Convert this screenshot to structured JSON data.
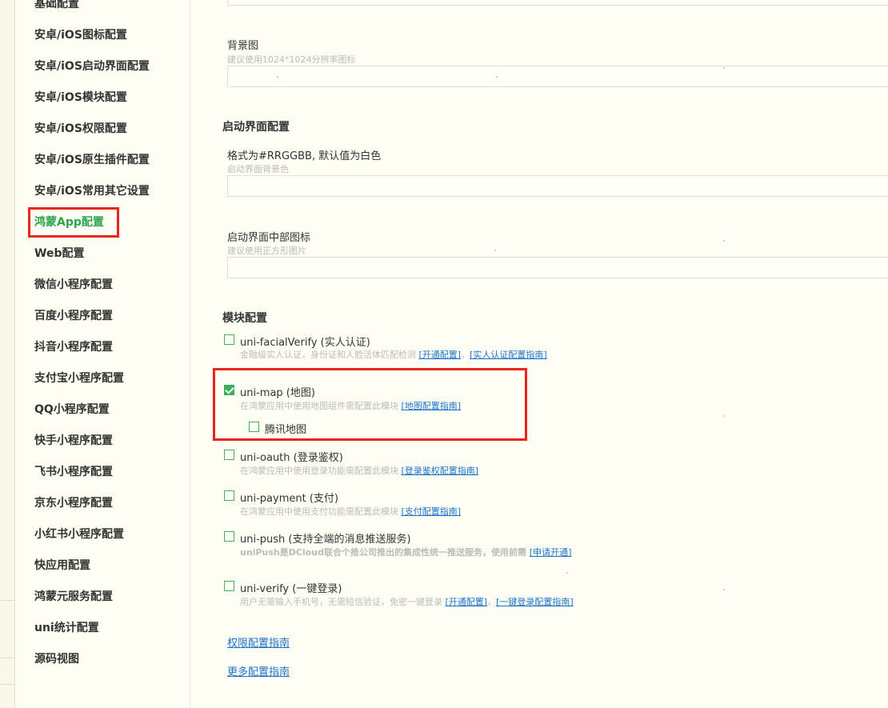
{
  "sidebar": {
    "items": [
      {
        "label": "基础配置",
        "active": false
      },
      {
        "label": "安卓/iOS图标配置",
        "active": false
      },
      {
        "label": "安卓/iOS启动界面配置",
        "active": false
      },
      {
        "label": "安卓/iOS模块配置",
        "active": false
      },
      {
        "label": "安卓/iOS权限配置",
        "active": false
      },
      {
        "label": "安卓/iOS原生插件配置",
        "active": false
      },
      {
        "label": "安卓/iOS常用其它设置",
        "active": false
      },
      {
        "label": "鸿蒙App配置",
        "active": true
      },
      {
        "label": "Web配置",
        "active": false
      },
      {
        "label": "微信小程序配置",
        "active": false
      },
      {
        "label": "百度小程序配置",
        "active": false
      },
      {
        "label": "抖音小程序配置",
        "active": false
      },
      {
        "label": "支付宝小程序配置",
        "active": false
      },
      {
        "label": "QQ小程序配置",
        "active": false
      },
      {
        "label": "快手小程序配置",
        "active": false
      },
      {
        "label": "飞书小程序配置",
        "active": false
      },
      {
        "label": "京东小程序配置",
        "active": false
      },
      {
        "label": "小红书小程序配置",
        "active": false
      },
      {
        "label": "快应用配置",
        "active": false
      },
      {
        "label": "鸿蒙元服务配置",
        "active": false
      },
      {
        "label": "uni统计配置",
        "active": false
      },
      {
        "label": "源码视图",
        "active": false
      }
    ],
    "active_color": "#2ea44f"
  },
  "main": {
    "background_field": {
      "label": "背景图",
      "hint": "建议使用1024*1024分辨率图标",
      "value": ""
    },
    "splash_section": {
      "title": "启动界面配置",
      "bg_color_field": {
        "label": "格式为#RRGGBB, 默认值为白色",
        "hint": "启动界面背景色",
        "value": ""
      },
      "icon_field": {
        "label": "启动界面中部图标",
        "hint": "建议使用正方形图片",
        "value": ""
      }
    },
    "modules_section": {
      "title": "模块配置",
      "modules": [
        {
          "title": "uni-facialVerify (实人认证)",
          "checked": false,
          "desc": "金融级实人认证，身份证和人脸活体匹配检测",
          "links": [
            "[开通配置]",
            "[实人认证配置指南]"
          ],
          "separator": "，"
        },
        {
          "title": "uni-map (地图)",
          "checked": true,
          "desc": "在鸿蒙应用中使用地图组件需配置此模块",
          "links": [
            "[地图配置指南]"
          ],
          "sub_option": {
            "label": "腾讯地图",
            "checked": false
          }
        },
        {
          "title": "uni-oauth (登录鉴权)",
          "checked": false,
          "desc": "在鸿蒙应用中使用登录功能需配置此模块",
          "links": [
            "[登录鉴权配置指南]"
          ]
        },
        {
          "title": "uni-payment (支付)",
          "checked": false,
          "desc": "在鸿蒙应用中使用支付功能需配置此模块",
          "links": [
            "[支付配置指南]"
          ]
        },
        {
          "title": "uni-push (支持全端的消息推送服务)",
          "checked": false,
          "desc": "uniPush是DCloud联合个推公司推出的集成性统一推送服务，使用前需",
          "links": [
            "[申请开通]"
          ]
        },
        {
          "title": "uni-verify (一键登录)",
          "checked": false,
          "desc": "用户无需输入手机号，无需短信验证，免密一键登录",
          "links": [
            "[开通配置]",
            "[一键登录配置指南]"
          ],
          "separator": "，"
        }
      ]
    },
    "links": {
      "permission_guide": "权限配置指南",
      "more_guide": "更多配置指南"
    },
    "colors": {
      "accent_green": "#3cae5a",
      "link_blue": "#1a73c9",
      "highlight_red": "#e8271a"
    }
  }
}
